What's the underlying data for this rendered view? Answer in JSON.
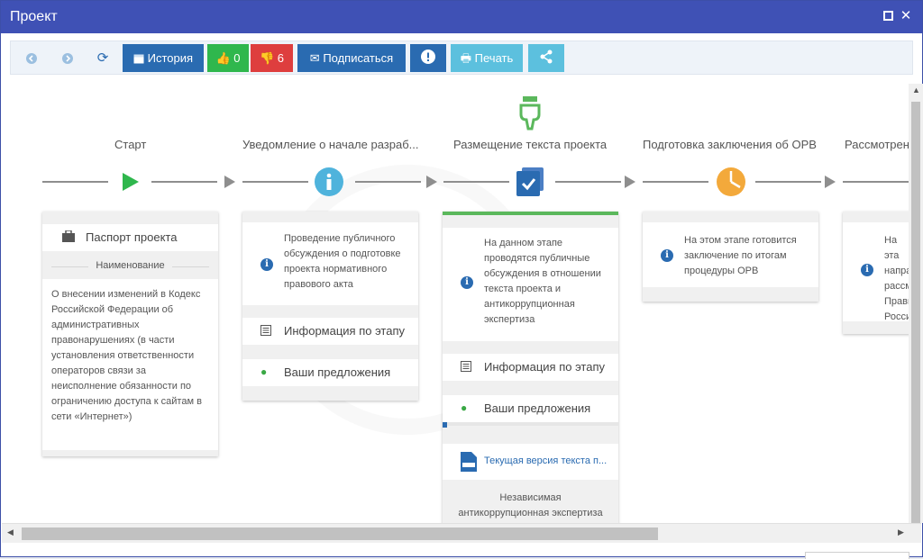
{
  "window": {
    "title": "Проект"
  },
  "toolbar": {
    "history": "История",
    "likes": "0",
    "dislikes": "6",
    "subscribe": "Подписаться",
    "print": "Печать"
  },
  "stages": [
    {
      "label": "Старт"
    },
    {
      "label": "Уведомление о начале разраб..."
    },
    {
      "label": "Размещение текста проекта"
    },
    {
      "label": "Подготовка заключения об ОРВ"
    },
    {
      "label": "Рассмотрение"
    }
  ],
  "card_start": {
    "passport": "Паспорт проекта",
    "name_label": "Наименование",
    "name_lines": [
      "О внесении изменений в Кодекс",
      "Российской Федерации об",
      "административных",
      "правонарушениях (в части",
      "установления ответственности",
      "операторов связи за",
      "неисполнение обязанности по",
      "ограничению доступа к сайтам в",
      "сети «Интернет»)"
    ]
  },
  "card_notice": {
    "desc_lines": [
      "Проведение публичного",
      "обсуждения о подготовке",
      "проекта нормативного",
      "правового акта"
    ],
    "stage_info": "Информация по этапу",
    "proposals": "Ваши предложения"
  },
  "card_text": {
    "desc_lines": [
      "На данном этапе",
      "проводятся публичные",
      "обсуждения в отношении",
      "текста проекта и",
      "антикоррупционная",
      "экспертиза"
    ],
    "stage_info": "Информация по этапу",
    "proposals": "Ваши предложения",
    "doc_link": "Текущая версия текста п...",
    "expertise_lines": [
      "Независимая",
      "антикоррупционная экспертиза"
    ]
  },
  "card_orv": {
    "desc_lines": [
      "На этом этапе готовится",
      "заключение по итогам",
      "процедуры ОРВ"
    ]
  },
  "card_review": {
    "desc_lines": [
      "На эта",
      "напра",
      "рассм",
      "Прави",
      "Росси"
    ]
  },
  "colors": {
    "titlebar": "#3f51b5",
    "primary": "#2a6bb1",
    "success": "#2fb74d",
    "danger": "#de3e3e",
    "info": "#5cc0de",
    "stage_info_icon": "#4fb3dc",
    "stage_orv_icon": "#f3a93b",
    "stage_active": "#5bb85c"
  }
}
